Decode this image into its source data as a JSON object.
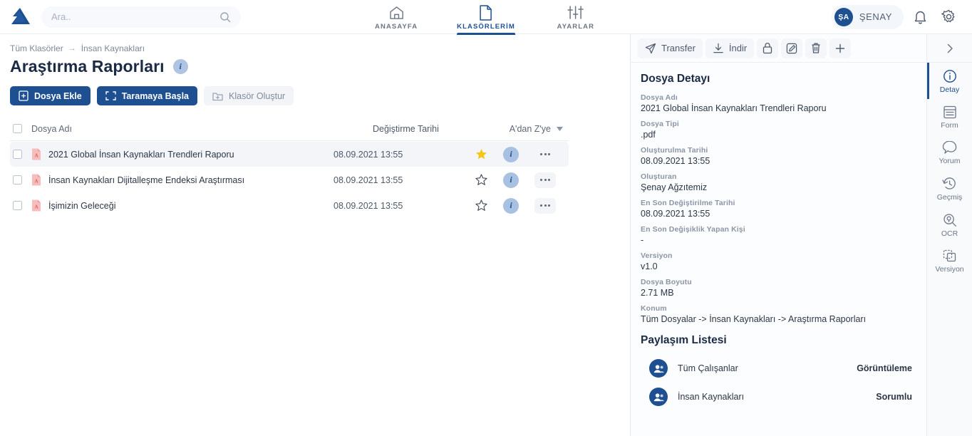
{
  "topbar": {
    "logo_name": "company-logo",
    "search": {
      "placeholder": "Ara..",
      "value": ""
    },
    "nav": [
      {
        "id": "anasayfa",
        "label": "ANASAYFA",
        "icon": "home-icon",
        "active": false
      },
      {
        "id": "klasorlerim",
        "label": "KLASÖRLERİM",
        "icon": "document-icon",
        "active": true
      },
      {
        "id": "ayarlar",
        "label": "AYARLAR",
        "icon": "sliders-icon",
        "active": false
      }
    ],
    "user": {
      "initials": "ŞA",
      "name": "ŞENAY"
    },
    "notification_icon": "bell-icon",
    "settings_icon": "gear-icon"
  },
  "left": {
    "breadcrumb": {
      "root": "Tüm Klasörler",
      "separator": "→",
      "current": "İnsan Kaynakları"
    },
    "page_title": "Araştırma Raporları",
    "title_info_glyph": "i",
    "actions": [
      {
        "id": "dosya-ekle",
        "label": "Dosya Ekle",
        "icon": "file-add-icon",
        "style": "primary"
      },
      {
        "id": "taramaya-basla",
        "label": "Taramaya Başla",
        "icon": "scan-icon",
        "style": "primary"
      },
      {
        "id": "klasor-olustur",
        "label": "Klasör Oluştur",
        "icon": "folder-add-icon",
        "style": "ghost"
      }
    ],
    "table": {
      "headers": {
        "name": "Dosya Adı",
        "date": "Değiştirme Tarihi",
        "sort": "A'dan Z'ye"
      },
      "rows": [
        {
          "name": "2021 Global İnsan Kaynakları Trendleri Raporu",
          "date": "08.09.2021 13:55",
          "type": "pdf",
          "starred": true,
          "selected": true
        },
        {
          "name": "İnsan Kaynakları Dijitalleşme Endeksi Araştırması",
          "date": "08.09.2021 13:55",
          "type": "pdf",
          "starred": false,
          "selected": false
        },
        {
          "name": "İşimizin Geleceği",
          "date": "08.09.2021 13:55",
          "type": "pdf",
          "starred": false,
          "selected": false
        }
      ]
    }
  },
  "right": {
    "toolbar": [
      {
        "id": "transfer",
        "label": "Transfer",
        "icon": "send-icon"
      },
      {
        "id": "indir",
        "label": "İndir",
        "icon": "download-icon"
      },
      {
        "id": "kilit",
        "label": "",
        "icon": "lock-icon"
      },
      {
        "id": "duzenle",
        "label": "",
        "icon": "edit-icon"
      },
      {
        "id": "sil",
        "label": "",
        "icon": "trash-icon"
      },
      {
        "id": "ekle",
        "label": "",
        "icon": "plus-icon"
      }
    ],
    "detail_title": "Dosya Detayı",
    "fields": [
      {
        "label": "Dosya Adı",
        "value": "2021 Global İnsan Kaynakları Trendleri Raporu"
      },
      {
        "label": "Dosya Tipi",
        "value": ".pdf"
      },
      {
        "label": "Oluşturulma Tarihi",
        "value": "08.09.2021 13:55"
      },
      {
        "label": "Oluşturan",
        "value": "Şenay Ağzıtemiz"
      },
      {
        "label": "En Son Değiştirilme Tarihi",
        "value": "08.09.2021 13:55"
      },
      {
        "label": "En Son Değişiklik Yapan Kişi",
        "value": "-"
      },
      {
        "label": "Versiyon",
        "value": "v1.0"
      },
      {
        "label": "Dosya Boyutu",
        "value": "2.71 MB"
      },
      {
        "label": "Konum",
        "value": "Tüm Dosyalar -> İnsan Kaynakları -> Araştırma Raporları"
      }
    ],
    "share_title": "Paylaşım Listesi",
    "shares": [
      {
        "name": "Tüm Çalışanlar",
        "role": "Görüntüleme",
        "icon": "group-icon"
      },
      {
        "name": "İnsan Kaynakları",
        "role": "Sorumlu",
        "icon": "group-icon"
      }
    ],
    "collapse_icon": "chevron-right-icon",
    "tabs": [
      {
        "id": "detay",
        "label": "Detay",
        "icon": "info-circle-icon",
        "active": true
      },
      {
        "id": "form",
        "label": "Form",
        "icon": "form-icon",
        "active": false
      },
      {
        "id": "yorum",
        "label": "Yorum",
        "icon": "comment-icon",
        "active": false
      },
      {
        "id": "gecmis",
        "label": "Geçmiş",
        "icon": "history-icon",
        "active": false
      },
      {
        "id": "ocr",
        "label": "OCR",
        "icon": "ocr-scan-icon",
        "active": false
      },
      {
        "id": "versiyon",
        "label": "Versiyon",
        "icon": "versions-icon",
        "active": false
      }
    ]
  },
  "colors": {
    "brand_blue": "#1d4f91",
    "row_selected": "#f3f5f8",
    "star_yellow": "#f5c518",
    "pdf_red": "#f4a0a0"
  }
}
